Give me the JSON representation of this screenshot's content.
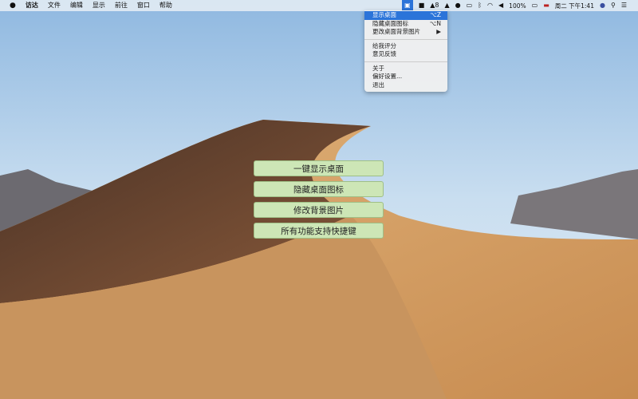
{
  "menubar": {
    "apple": "",
    "items": [
      "访达",
      "文件",
      "编辑",
      "显示",
      "前往",
      "窗口",
      "帮助"
    ],
    "status": {
      "qq_count": "8",
      "battery": "100%",
      "datetime": "周二 下午1:41"
    }
  },
  "dropdown": {
    "items": [
      {
        "label": "显示桌面",
        "shortcut": "⌥Z"
      },
      {
        "label": "隐藏桌面图标",
        "shortcut": "⌥N"
      },
      {
        "label": "更改桌面背景图片",
        "shortcut": "▶"
      },
      {
        "label": "给我评分",
        "shortcut": ""
      },
      {
        "label": "意见反馈",
        "shortcut": ""
      },
      {
        "label": "关于",
        "shortcut": ""
      },
      {
        "label": "偏好设置...",
        "shortcut": ""
      },
      {
        "label": "退出",
        "shortcut": ""
      }
    ]
  },
  "buttons": [
    "一键显示桌面",
    "隐藏桌面图标",
    "修改背景图片",
    "所有功能支持快捷键"
  ],
  "colors": {
    "accent": "#2b74d9",
    "button": "#cde6b6"
  }
}
